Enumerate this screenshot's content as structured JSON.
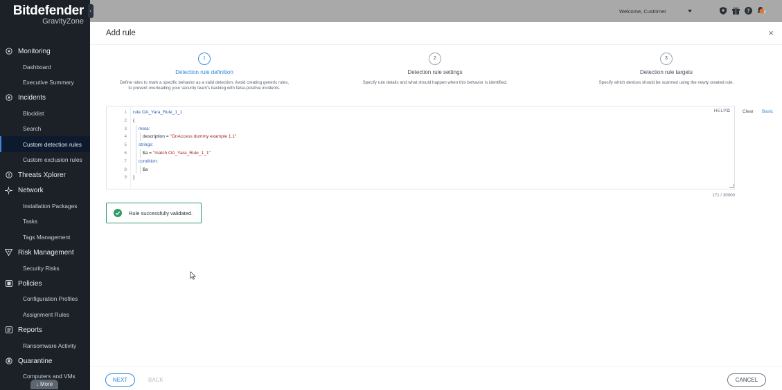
{
  "brand": {
    "name": "Bitdefender",
    "product": "GravityZone"
  },
  "sidebar": {
    "sections": [
      {
        "label": "Monitoring",
        "icon": "monitoring-icon",
        "items": [
          "Dashboard",
          "Executive Summary"
        ]
      },
      {
        "label": "Incidents",
        "icon": "incidents-icon",
        "items": [
          "Blocklist",
          "Search",
          "Custom detection rules",
          "Custom exclusion rules"
        ]
      },
      {
        "label": "Threats Xplorer",
        "icon": "threats-icon",
        "items": []
      },
      {
        "label": "Network",
        "icon": "network-icon",
        "items": [
          "Installation Packages",
          "Tasks",
          "Tags Management"
        ]
      },
      {
        "label": "Risk Management",
        "icon": "risk-icon",
        "items": [
          "Security Risks"
        ]
      },
      {
        "label": "Policies",
        "icon": "policies-icon",
        "items": [
          "Configuration Profiles",
          "Assignment Rules"
        ]
      },
      {
        "label": "Reports",
        "icon": "reports-icon",
        "items": [
          "Ransomware Activity"
        ]
      },
      {
        "label": "Quarantine",
        "icon": "quarantine-icon",
        "items": [
          "Computers and VMs"
        ]
      }
    ],
    "active_item": "Custom detection rules",
    "more_label": "↓ More"
  },
  "topbar": {
    "welcome": "Welcome, Customer",
    "icons": [
      "shield-icon",
      "gift-icon",
      "help-icon",
      "notifications-icon"
    ],
    "notification_count": "9"
  },
  "modal": {
    "title": "Add rule",
    "close": "×",
    "steps": [
      {
        "number": "1",
        "title": "Detection rule definition",
        "desc_lines": [
          "Define rules to mark a specific behavior as a valid detection. Avoid creating generic rules,",
          "to prevent overloading your security team's backlog with false-positive incidents."
        ],
        "current": true
      },
      {
        "number": "2",
        "title": "Detection rule settings",
        "desc_lines": [
          "Specify rule details and what should happen when this behavior is identified."
        ],
        "current": false
      },
      {
        "number": "3",
        "title": "Detection rule targets",
        "desc_lines": [
          "Specify which devices should be scanned using the newly created rule."
        ],
        "current": false
      }
    ],
    "editor": {
      "line_numbers": [
        "1",
        "2",
        "3",
        "4",
        "5",
        "6",
        "7",
        "8",
        "9"
      ],
      "lines": [
        {
          "parts": [
            {
              "t": "rule OA_Yara_Rule_1_1",
              "c": "kw-blue"
            }
          ]
        },
        {
          "parts": [
            {
              "t": "{",
              "c": ""
            }
          ]
        },
        {
          "parts": [
            {
              "t": "meta:",
              "c": "kw-blue"
            }
          ]
        },
        {
          "parts": [
            {
              "t": "description = ",
              "c": ""
            },
            {
              "t": "\"OnAccess dummy example 1.1\"",
              "c": "str-red"
            }
          ]
        },
        {
          "parts": [
            {
              "t": "strings:",
              "c": "kw-blue"
            }
          ]
        },
        {
          "parts": [
            {
              "t": "$a = ",
              "c": ""
            },
            {
              "t": "\"match OA_Yara_Rule_1_1\"",
              "c": "str-red"
            }
          ]
        },
        {
          "parts": [
            {
              "t": "condition:",
              "c": "kw-blue"
            }
          ]
        },
        {
          "parts": [
            {
              "t": "$a",
              "c": ""
            }
          ]
        },
        {
          "parts": [
            {
              "t": "}",
              "c": ""
            }
          ]
        }
      ],
      "help_label": "HELP⧉",
      "clear_label": "Clear",
      "basic_label": "Basic",
      "counter": "171 / 30000"
    },
    "validation": "Rule successfully validated.",
    "footer": {
      "next": "NEXT",
      "back": "BACK",
      "cancel": "CANCEL"
    }
  },
  "colors": {
    "accent": "#2f86d9",
    "success": "#2f9c6a",
    "sidebar_bg": "#1c2128",
    "notification": "#e2742f"
  }
}
